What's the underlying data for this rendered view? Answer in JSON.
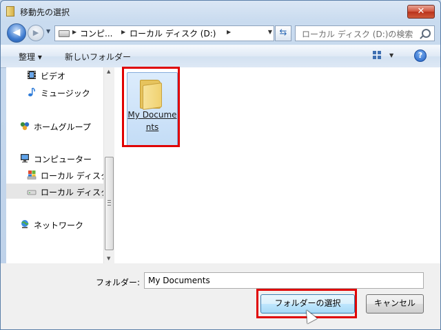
{
  "window": {
    "title": "移動先の選択",
    "close_label": "✕"
  },
  "address": {
    "crumbs": [
      "コンピ...",
      "ローカル ディスク (D:)"
    ],
    "search_placeholder": "ローカル ディスク (D:)の検索"
  },
  "toolbar": {
    "organize_label": "整理 ▾",
    "new_folder_label": "新しいフォルダー",
    "help_label": "?"
  },
  "nav": {
    "items": [
      {
        "label": "ビデオ",
        "icon": "video-icon"
      },
      {
        "label": "ミュージック",
        "icon": "music-icon"
      },
      {
        "label": "ホームグループ",
        "icon": "homegroup-icon"
      },
      {
        "label": "コンピューター",
        "icon": "computer-icon"
      },
      {
        "label": "ローカル ディスク",
        "icon": "windows-drive-icon"
      },
      {
        "label": "ローカル ディスク",
        "icon": "drive-icon",
        "selected": true
      },
      {
        "label": "ネットワーク",
        "icon": "network-icon"
      }
    ]
  },
  "content": {
    "folders": [
      {
        "name": "My Documents",
        "icon": "folder-icon"
      }
    ]
  },
  "bottom": {
    "folder_label": "フォルダー:",
    "folder_value": "My Documents",
    "select_button": "フォルダーの選択",
    "cancel_button": "キャンセル"
  },
  "colors": {
    "highlight": "#e00000",
    "selection": "#c3dcf6"
  }
}
